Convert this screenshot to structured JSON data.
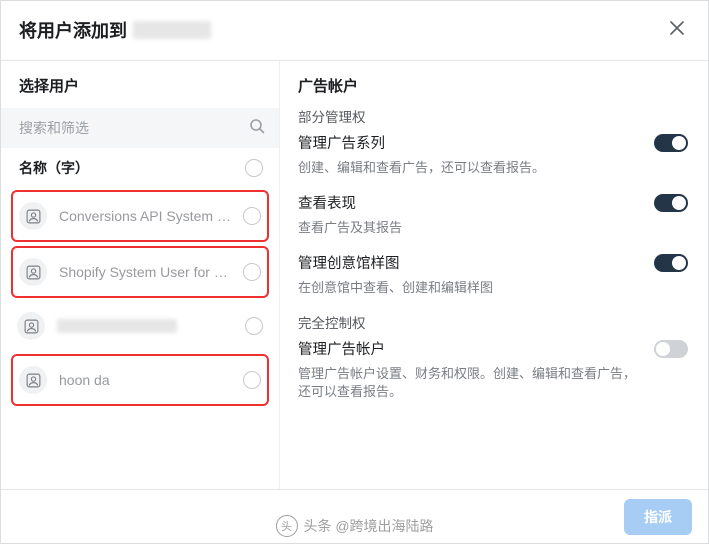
{
  "header": {
    "title_prefix": "将用户添加到"
  },
  "left": {
    "title": "选择用户",
    "search_placeholder": "搜索和筛选",
    "col_header": "名称（字）",
    "users": [
      {
        "name": "Conversions API System U...",
        "highlighted": true
      },
      {
        "name": "Shopify System User for Re...",
        "highlighted": true
      },
      {
        "name": "",
        "highlighted": false,
        "blurred": true
      },
      {
        "name": "hoon da",
        "highlighted": true
      }
    ]
  },
  "right": {
    "title": "广告帐户",
    "sections": [
      {
        "label": "部分管理权",
        "items": [
          {
            "title": "管理广告系列",
            "desc": "创建、编辑和查看广告，还可以查看报告。",
            "on": true
          },
          {
            "title": "查看表现",
            "desc": "查看广告及其报告",
            "on": true
          },
          {
            "title": "管理创意馆样图",
            "desc": "在创意馆中查看、创建和编辑样图",
            "on": true
          }
        ]
      },
      {
        "label": "完全控制权",
        "items": [
          {
            "title": "管理广告帐户",
            "desc": "管理广告帐户设置、财务和权限。创建、编辑和查看广告，还可以查看报告。",
            "on": false
          }
        ]
      }
    ]
  },
  "footer": {
    "confirm": "指派"
  },
  "watermark": "头条 @跨境出海陆路"
}
